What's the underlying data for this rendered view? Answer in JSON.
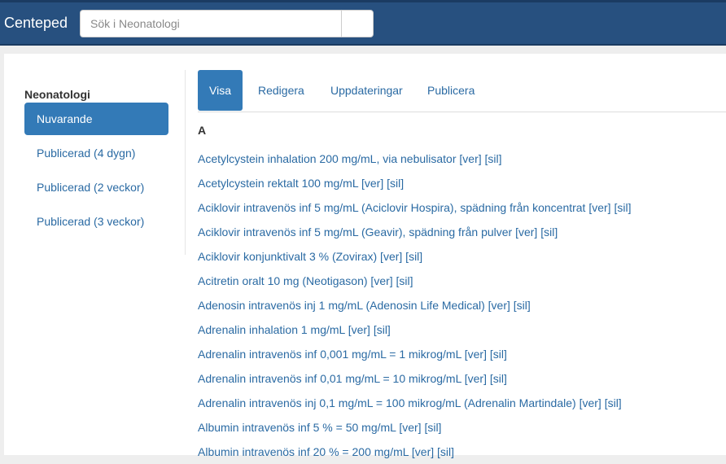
{
  "header": {
    "brand": "Centeped",
    "search_placeholder": "Sök i Neonatologi"
  },
  "sidebar": {
    "title": "Neonatologi",
    "items": [
      {
        "label": "Nuvarande",
        "active": true
      },
      {
        "label": "Publicerad (4 dygn)",
        "active": false
      },
      {
        "label": "Publicerad (2 veckor)",
        "active": false
      },
      {
        "label": "Publicerad (3 veckor)",
        "active": false
      }
    ]
  },
  "tabs": [
    {
      "label": "Visa",
      "active": true
    },
    {
      "label": "Redigera",
      "active": false
    },
    {
      "label": "Uppdateringar",
      "active": false
    },
    {
      "label": "Publicera",
      "active": false
    }
  ],
  "content": {
    "letter": "A",
    "items": [
      "Acetylcystein inhalation 200 mg/mL, via nebulisator [ver] [sil]",
      "Acetylcystein rektalt 100 mg/mL [ver] [sil]",
      "Aciklovir intravenös inf 5 mg/mL (Aciclovir Hospira), spädning från koncentrat [ver] [sil]",
      "Aciklovir intravenös inf 5 mg/mL (Geavir), spädning från pulver [ver] [sil]",
      "Aciklovir konjunktivalt 3 % (Zovirax) [ver] [sil]",
      "Acitretin oralt 10 mg (Neotigason) [ver] [sil]",
      "Adenosin intravenös inj 1 mg/mL (Adenosin Life Medical) [ver] [sil]",
      "Adrenalin inhalation 1 mg/mL [ver] [sil]",
      "Adrenalin intravenös inf 0,001 mg/mL = 1 mikrog/mL [ver] [sil]",
      "Adrenalin intravenös inf 0,01 mg/mL = 10 mikrog/mL [ver] [sil]",
      "Adrenalin intravenös inj 0,1 mg/mL = 100 mikrog/mL (Adrenalin Martindale) [ver] [sil]",
      "Albumin intravenös inf 5 % = 50 mg/mL [ver] [sil]",
      "Albumin intravenös inf 20 % = 200 mg/mL [ver] [sil]"
    ]
  },
  "colors": {
    "header_bg": "#27507f",
    "accent": "#337ab7",
    "link": "#2a6aa3"
  }
}
